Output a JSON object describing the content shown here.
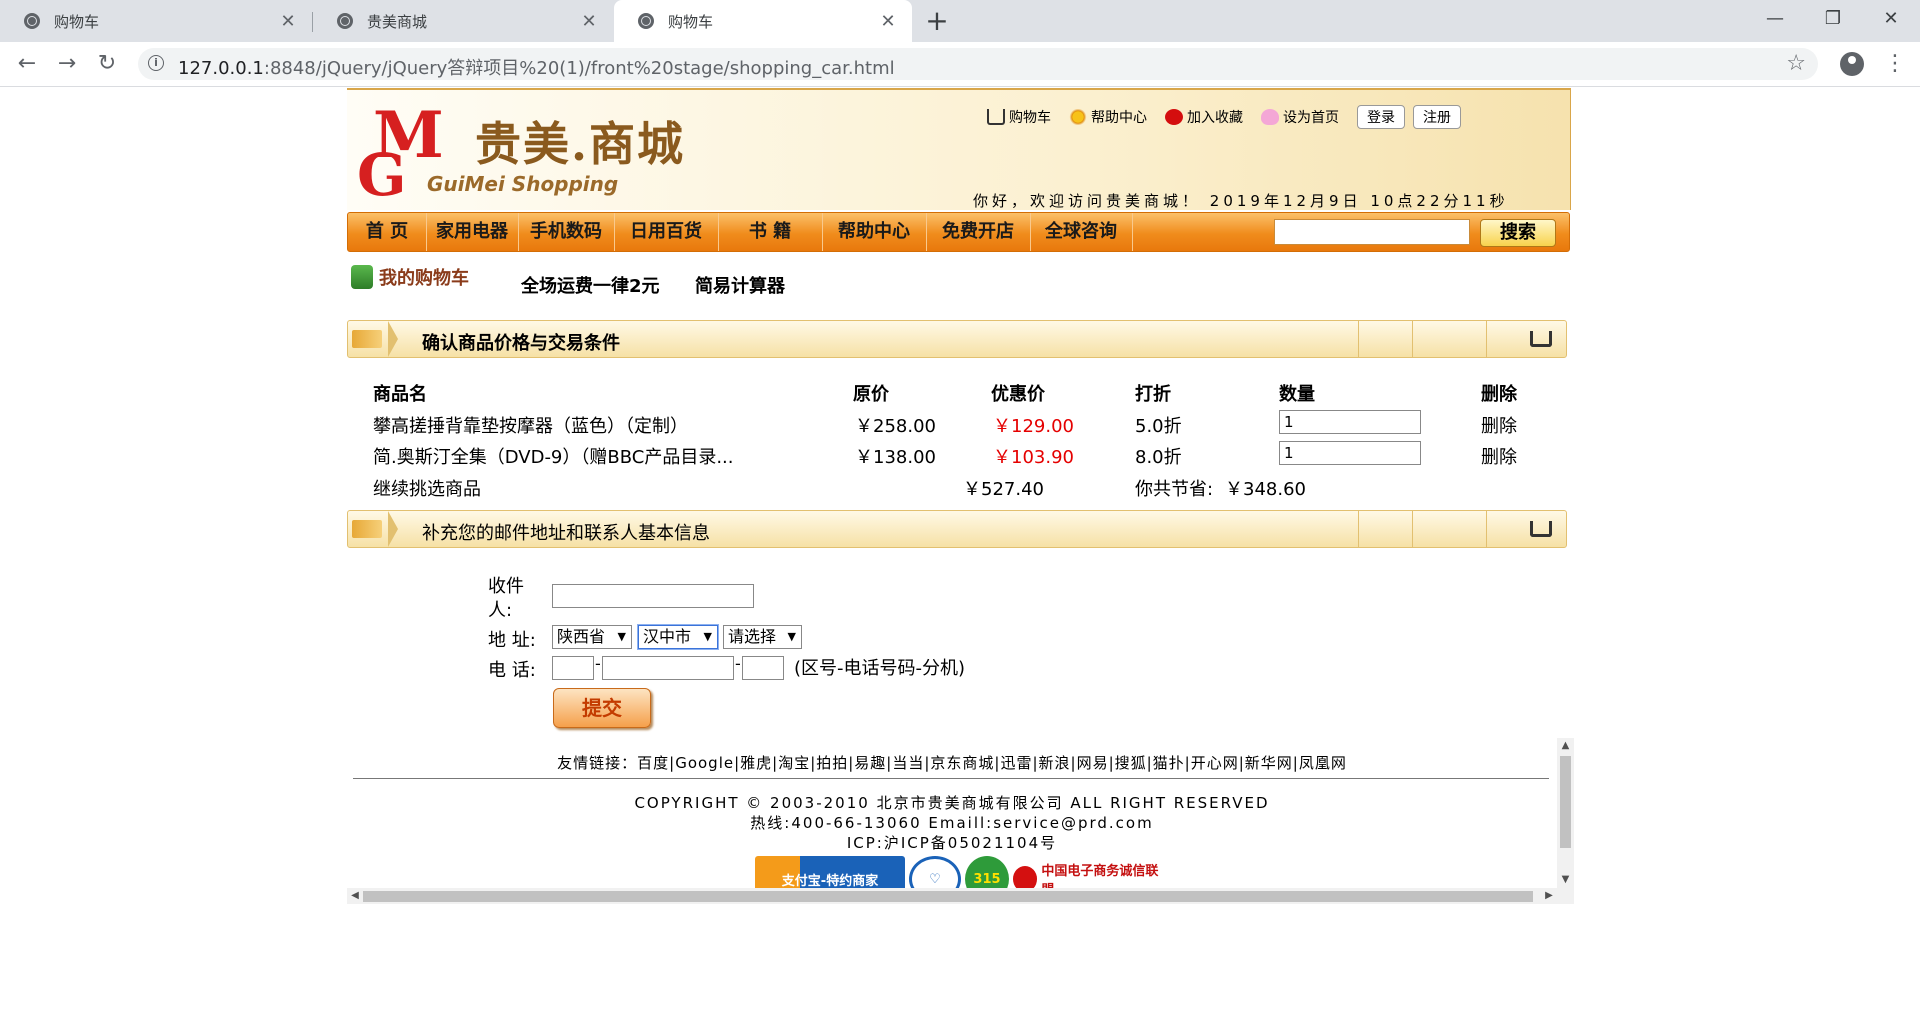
{
  "browser": {
    "tabs": [
      {
        "title": "购物车",
        "active": false
      },
      {
        "title": "贵美商城",
        "active": false
      },
      {
        "title": "购物车",
        "active": true
      }
    ],
    "url_host": "127.0.0.1",
    "url_rest": ":8848/jQuery/jQuery答辩项目%20(1)/front%20stage/shopping_car.html"
  },
  "header": {
    "logo_m": "M",
    "logo_g": "G",
    "logo_cn": "贵美.商城",
    "logo_en": "GuiMei Shopping",
    "toplinks": [
      "购物车",
      "帮助中心",
      "加入收藏",
      "设为首页"
    ],
    "login": "登录",
    "register": "注册",
    "welcome": "你好，欢迎访问贵美商城！ 2019年12月9日  10点22分11秒"
  },
  "nav": {
    "items": [
      "首 页",
      "家用电器",
      "手机数码",
      "日用百货",
      "书 籍",
      "帮助中心",
      "免费开店",
      "全球咨询"
    ],
    "search_button": "搜索"
  },
  "subnav": {
    "my_cart": "我的购物车",
    "shipping": "全场运费一律2元",
    "calculator": "简易计算器"
  },
  "cart": {
    "section_title": "确认商品价格与交易条件",
    "columns": [
      "商品名",
      "原价",
      "优惠价",
      "打折",
      "数量",
      "删除"
    ],
    "rows": [
      {
        "name": "攀高搓捶背靠垫按摩器（蓝色）（定制）",
        "price": "￥258.00",
        "sale": "￥129.00",
        "discount": "5.0折",
        "qty": "1",
        "delete": "删除"
      },
      {
        "name": "简.奥斯汀全集（DVD-9）（赠BBC产品目录...",
        "price": "￥138.00",
        "sale": "￥103.90",
        "discount": "8.0折",
        "qty": "1",
        "delete": "删除"
      }
    ],
    "continue": "继续挑选商品",
    "total": "￥527.40",
    "saved_label": "你共节省:",
    "saved_value": "￥348.60"
  },
  "address": {
    "section_title": "补充您的邮件地址和联系人基本信息",
    "receiver_label_1": "收件",
    "receiver_label_2": "人:",
    "address_label": "地  址:",
    "province": "陕西省",
    "city": "汉中市",
    "district": "请选择",
    "phone_label": "电  话:",
    "phone_hint": "(区号-电话号码-分机)",
    "submit": "提交"
  },
  "footer": {
    "friend_links": "友情链接：百度|Google|雅虎|淘宝|拍拍|易趣|当当|京东商城|迅雷|新浪|网易|搜狐|猫扑|开心网|新华网|凤凰网",
    "copyright": "COPYRIGHT © 2003-2010 北京市贵美商城有限公司 ALL RIGHT RESERVED",
    "hotline": "热线:400-66-13060 Emaill:service@prd.com",
    "icp": "ICP:沪ICP备05021104号",
    "badge_alipay": "支付宝-特约商家",
    "badge_315": "315",
    "badge_union": "中国电子商务诚信联盟"
  }
}
